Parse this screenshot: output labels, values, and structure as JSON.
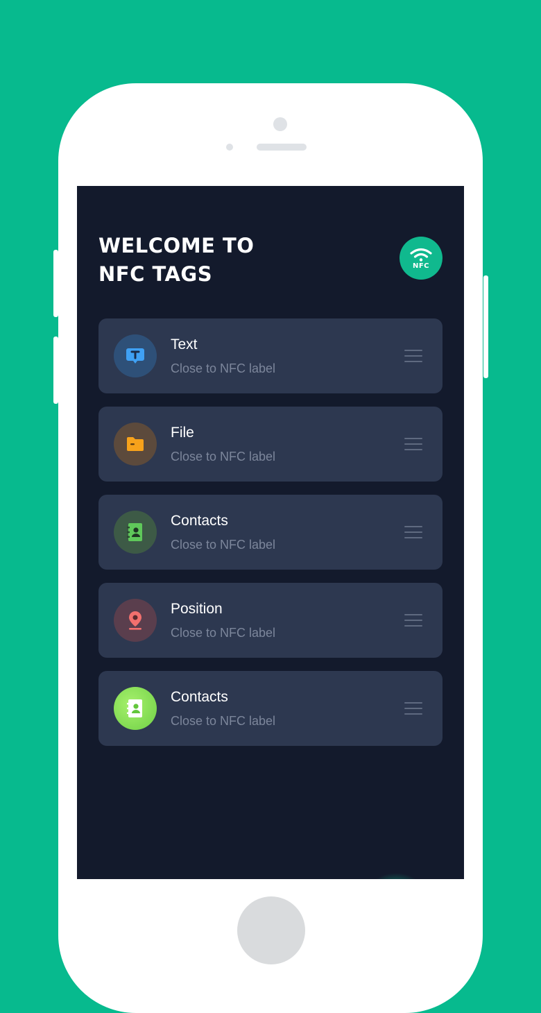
{
  "app": {
    "title": "WELCOME TO\nNFC TAGS",
    "badge_label": "NFC"
  },
  "items": [
    {
      "title": "Text",
      "subtitle": "Close to NFC label",
      "icon": "text-icon",
      "icon_bg": "#2e5078",
      "icon_color": "#3fa1f4"
    },
    {
      "title": "File",
      "subtitle": "Close to NFC label",
      "icon": "folder-icon",
      "icon_bg": "#5c4a3c",
      "icon_color": "#f7a21b"
    },
    {
      "title": "Contacts",
      "subtitle": "Close to NFC label",
      "icon": "contact-book-icon",
      "icon_bg": "#3d5a46",
      "icon_color": "#5fc85a"
    },
    {
      "title": "Position",
      "subtitle": "Close to NFC label",
      "icon": "location-pin-icon",
      "icon_bg": "#5a3e4d",
      "icon_color": "#f2706e"
    },
    {
      "title": "Contacts",
      "subtitle": "Close to NFC label",
      "icon": "contact-book-icon",
      "icon_bg": "#8ee05a",
      "icon_color": "#ffffff"
    }
  ],
  "colors": {
    "background": "#07ba8e",
    "screen": "#131a2c",
    "card": "#2d3850",
    "accent": "#10b98e"
  }
}
